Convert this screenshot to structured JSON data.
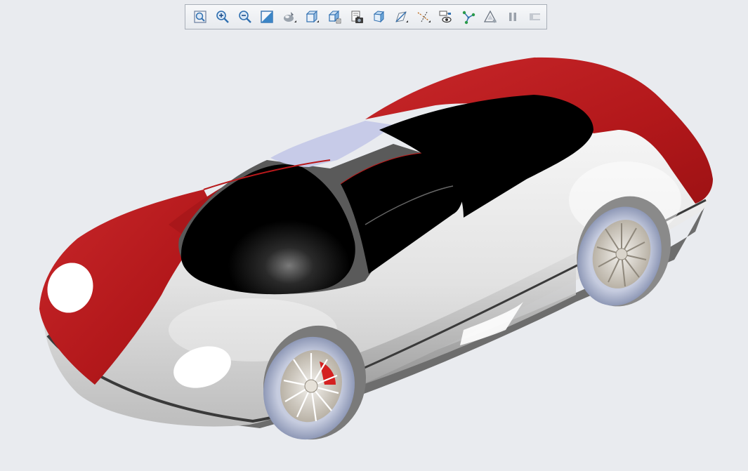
{
  "toolbar": {
    "items": [
      {
        "icon": "refit-icon"
      },
      {
        "icon": "zoom-in-icon"
      },
      {
        "icon": "zoom-out-icon"
      },
      {
        "icon": "repaint-icon"
      },
      {
        "icon": "display-style-icon"
      },
      {
        "icon": "saved-orientations-icon"
      },
      {
        "icon": "view-manager-icon"
      },
      {
        "icon": "snapshot-icon"
      },
      {
        "icon": "perspective-view-icon"
      },
      {
        "icon": "datum-planes-icon"
      },
      {
        "icon": "datum-axes-icon"
      },
      {
        "icon": "annotation-display-icon"
      },
      {
        "icon": "datum-points-icon"
      },
      {
        "icon": "coordinate-systems-icon"
      },
      {
        "icon": "pause-icon"
      },
      {
        "icon": "spin-center-icon"
      }
    ]
  },
  "model": {
    "name": "sports-car-model",
    "colors": {
      "body_red": "#b8191b",
      "body_white": "#e6e6e6",
      "glass": "#000000",
      "roof_strip": "#c5c9e6",
      "tire": "#b6bfd8",
      "rim": "#cfc8bd",
      "brake": "#d42020",
      "background": "#e9ebef"
    }
  }
}
